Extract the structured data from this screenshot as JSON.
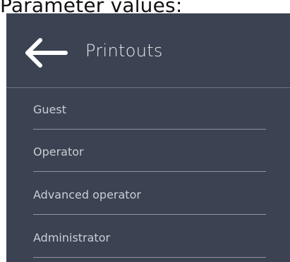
{
  "caption": "Parameter values:",
  "header": {
    "back_icon": "arrow-left-icon",
    "title": "Printouts"
  },
  "menu": {
    "items": [
      {
        "label": "Guest"
      },
      {
        "label": "Operator"
      },
      {
        "label": "Advanced operator"
      },
      {
        "label": "Administrator"
      }
    ]
  },
  "colors": {
    "panel_background": "#3b4352",
    "text": "#c9ced6",
    "divider": "#8c93a0",
    "accent": "#ffffff"
  }
}
